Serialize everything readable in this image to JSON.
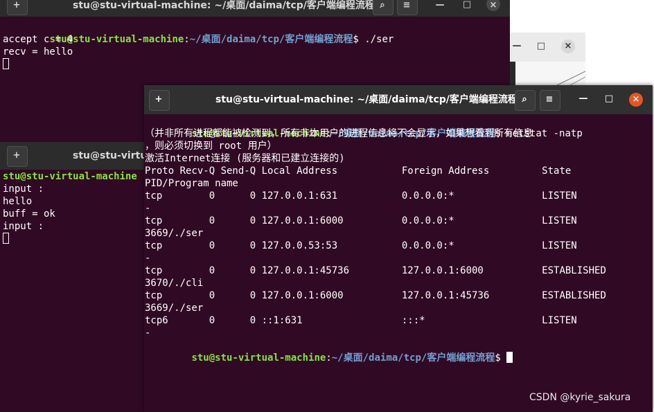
{
  "prompt": {
    "userhost": "stu@stu-virtual-machine",
    "sep": ":",
    "path": "~/桌面/daima/tcp/客户端编程流程",
    "sym": "$ "
  },
  "win1": {
    "title": "stu@stu-virtual-machine: ~/桌面/daima/tcp/客户端编程流程",
    "command": "./ser",
    "lines": [
      "accept c = 4",
      "recv = hello"
    ]
  },
  "win2": {
    "title_fragment": "stu@stu-virtual-ma",
    "prompt_fragment": "stu@stu-virtual-machine",
    "lines": [
      "input :",
      "hello",
      "buff = ok",
      "input :"
    ]
  },
  "win3": {
    "title": "stu@stu-virtual-machine: ~/桌面/daima/tcp/客户端编程流程",
    "command": "netstat -natp",
    "output": [
      "（并非所有进程都能被检测到，所有非本用户的进程信息将不会显示，如果想看到所有信息",
      "，则必须切换到 root 用户）",
      "激活Internet连接 (服务器和已建立连接的)",
      "Proto Recv-Q Send-Q Local Address           Foreign Address         State",
      "PID/Program name",
      "tcp        0      0 127.0.0.1:631           0.0.0.0:*               LISTEN",
      "-",
      "tcp        0      0 127.0.0.1:6000          0.0.0.0:*               LISTEN",
      "3669/./ser",
      "tcp        0      0 127.0.0.53:53           0.0.0.0:*               LISTEN",
      "-",
      "tcp        0      0 127.0.0.1:45736         127.0.0.1:6000          ESTABLISHED",
      "3670/./cli",
      "tcp        0      0 127.0.0.1:6000          127.0.0.1:45736         ESTABLISHED",
      "3669/./ser",
      "tcp6       0      0 ::1:631                 :::*                    LISTEN",
      "-"
    ]
  },
  "buttons": {
    "new_tab": "+",
    "search": "⌕",
    "menu": "≡",
    "minimize": "—",
    "maximize": "□",
    "close": "×"
  },
  "watermark": "CSDN @kyrie_sakura",
  "colors": {
    "terminal_bg": "#300a24",
    "prompt_user": "#8ae234",
    "prompt_path": "#729fcf",
    "close_active": "#e95420",
    "titlebar": "#2c2c2c"
  }
}
